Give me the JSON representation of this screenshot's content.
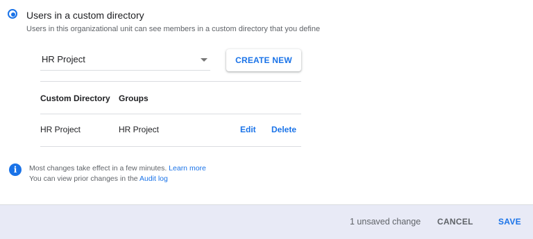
{
  "option": {
    "label": "Users in a custom directory",
    "description": "Users in this organizational unit can see members in a custom directory that you define",
    "selected": true
  },
  "dropdown": {
    "value": "HR Project",
    "icon": "chevron-down-icon"
  },
  "create_button": {
    "label": "CREATE NEW"
  },
  "table": {
    "headers": [
      "Custom Directory",
      "Groups"
    ],
    "rows": [
      {
        "directory": "HR Project",
        "groups": "HR Project",
        "edit_label": "Edit",
        "delete_label": "Delete"
      }
    ]
  },
  "info": {
    "icon": "info-icon",
    "line1_text": "Most changes take effect in a few minutes.",
    "line1_link": "Learn more",
    "line2_text": "You can view prior changes in the",
    "line2_link": "Audit log"
  },
  "footer": {
    "status": "1 unsaved change",
    "cancel_label": "CANCEL",
    "save_label": "SAVE"
  },
  "colors": {
    "accent": "#1a73e8",
    "footer_bg": "#e8eaf6",
    "secondary_text": "#5f6368"
  }
}
